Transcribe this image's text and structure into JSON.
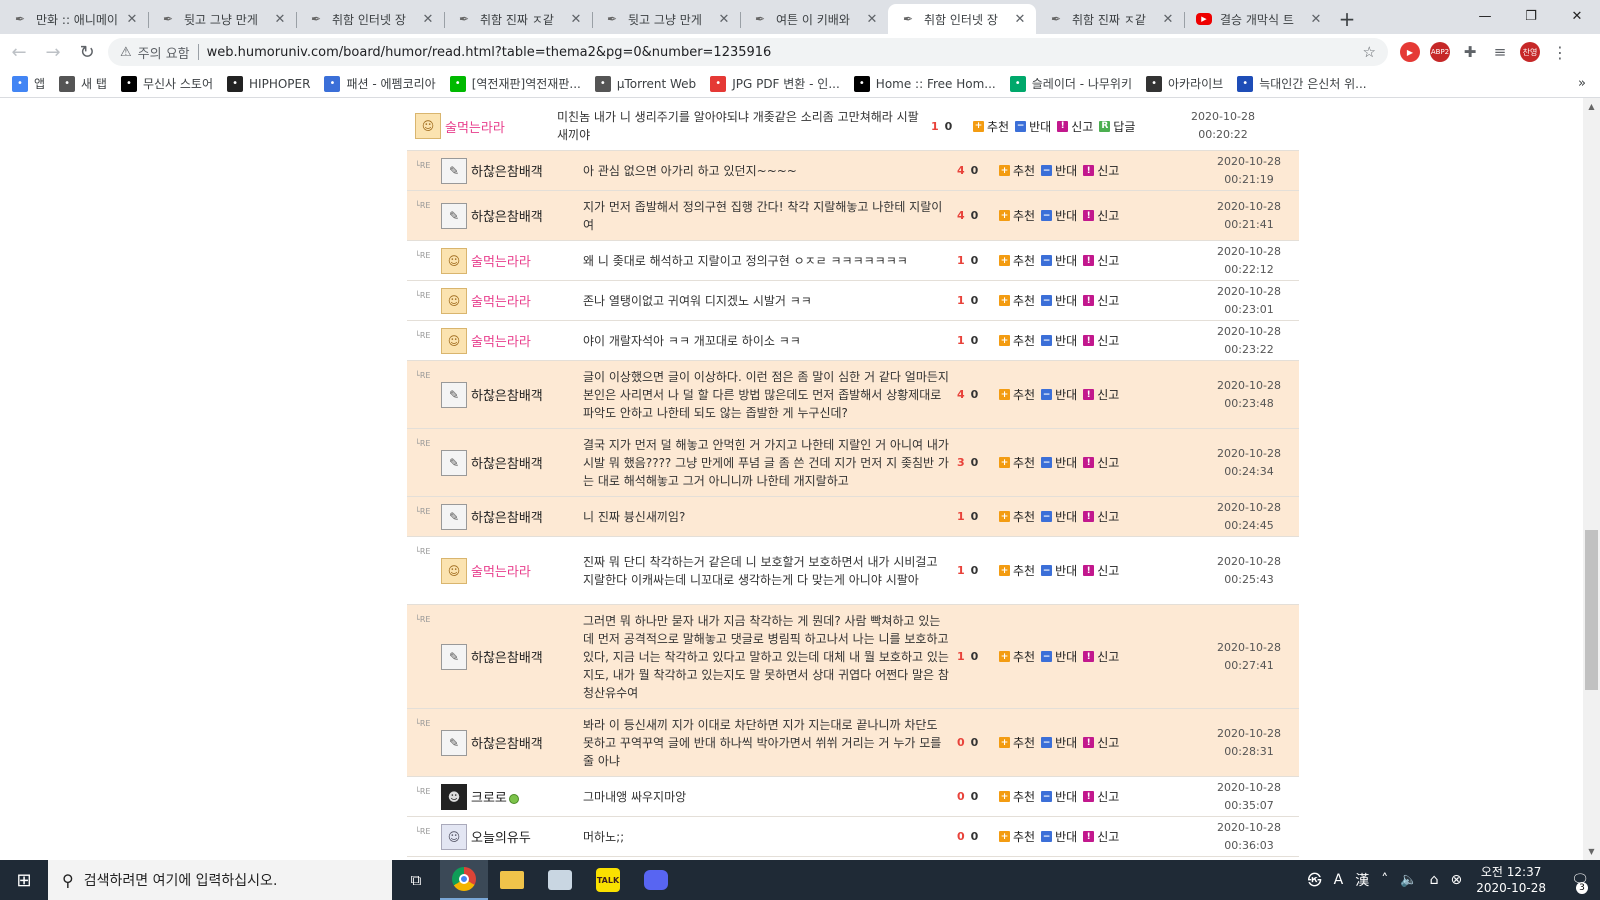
{
  "tabs": [
    {
      "title": "만화 :: 애니메이",
      "icon": "site-icon"
    },
    {
      "title": "뒷고 그냥 만게",
      "icon": "site-icon"
    },
    {
      "title": "취함 인터넷 장",
      "icon": "site-icon"
    },
    {
      "title": "취함 진짜 ㅈ같",
      "icon": "site-icon"
    },
    {
      "title": "뒷고 그냥 만게",
      "icon": "site-icon"
    },
    {
      "title": "여튼 이 키배와",
      "icon": "site-icon"
    },
    {
      "title": "취함 인터넷 장",
      "icon": "site-icon",
      "active": true
    },
    {
      "title": "취함 진짜 ㅈ같",
      "icon": "site-icon"
    },
    {
      "title": "결승 개막식 트",
      "icon": "youtube-icon"
    }
  ],
  "toolbar": {
    "security_label": "주의 요함",
    "url": "web.humoruniv.com/board/humor/read.html?table=thema2&pg=0&number=1235916"
  },
  "extensions": {
    "abp_badge": "2",
    "profile_label": "찬영"
  },
  "bookmarks": [
    {
      "label": "앱",
      "icon": "apps-icon",
      "color": "#4285f4"
    },
    {
      "label": "새 탭",
      "icon": "globe-icon",
      "color": "#555555"
    },
    {
      "label": "무신사 스토어",
      "icon": "musinsa-icon",
      "color": "#000000"
    },
    {
      "label": "HIPHOPER",
      "icon": "hiphoper-icon",
      "color": "#222222"
    },
    {
      "label": "패션 - 에펨코리아",
      "icon": "fmkorea-icon",
      "color": "#3b6fd8"
    },
    {
      "label": "[역전재판]역전재판...",
      "icon": "line-icon",
      "color": "#00b900"
    },
    {
      "label": "µTorrent Web",
      "icon": "utorrent-icon",
      "color": "#555555"
    },
    {
      "label": "JPG PDF 변환 - 인...",
      "icon": "grid-icon",
      "color": "#e53935"
    },
    {
      "label": "Home :: Free Hom...",
      "icon": "s-icon",
      "color": "#000000"
    },
    {
      "label": "슬레이더 - 나무위키",
      "icon": "namu-icon",
      "color": "#00a86b"
    },
    {
      "label": "아카라이브",
      "icon": "arca-icon",
      "color": "#333333"
    },
    {
      "label": "늑대인간 은신처 위...",
      "icon": "cube-icon",
      "color": "#1e4db7"
    }
  ],
  "comment_actions": {
    "recommend": "추천",
    "oppose": "반대",
    "report": "신고",
    "reply": "답글"
  },
  "comments": [
    {
      "reply": false,
      "avatar": "cat",
      "nick": "술먹는라라",
      "nick_color": "pink",
      "text": "미친놈 내가 니 생리주기를 알아야되냐 개좆같은 소리좀 고만쳐해라 시팔새끼야",
      "up": "1",
      "down": "0",
      "date": "2020-10-28",
      "time": "00:20:22",
      "has_reply_btn": true
    },
    {
      "reply": true,
      "avatar": "sketch",
      "nick": "하찮은참배객",
      "text": "아 관심 없으면 아가리 하고 있던지~~~~",
      "up": "4",
      "down": "0",
      "date": "2020-10-28",
      "time": "00:21:19"
    },
    {
      "reply": true,
      "avatar": "sketch",
      "nick": "하찮은참배객",
      "text": "지가 먼저 좁발해서 정의구현 집행 간다! 착각 지랄해놓고 나한테 지랄이여",
      "up": "4",
      "down": "0",
      "date": "2020-10-28",
      "time": "00:21:41"
    },
    {
      "reply": true,
      "avatar": "cat",
      "nick": "술먹는라라",
      "nick_color": "pink",
      "text": "왜 니 좆대로 해석하고 지랄이고 정의구현 ㅇㅈㄹ ㅋㅋㅋㅋㅋㅋㅋ",
      "up": "1",
      "down": "0",
      "date": "2020-10-28",
      "time": "00:22:12"
    },
    {
      "reply": true,
      "avatar": "cat",
      "nick": "술먹는라라",
      "nick_color": "pink",
      "text": "존나 열탱이없고 귀여워 디지겠노 시발거 ㅋㅋ",
      "up": "1",
      "down": "0",
      "date": "2020-10-28",
      "time": "00:23:01"
    },
    {
      "reply": true,
      "avatar": "cat",
      "nick": "술먹는라라",
      "nick_color": "pink",
      "text": "야이 개랄자석아 ㅋㅋ 개꼬대로 하이소 ㅋㅋ",
      "up": "1",
      "down": "0",
      "date": "2020-10-28",
      "time": "00:23:22"
    },
    {
      "reply": true,
      "avatar": "sketch",
      "nick": "하찮은참배객",
      "text": "글이 이상했으면 글이 이상하다. 이런 점은 좀 말이 심한 거 같다 얼마든지 본인은 사리면서 나 덜 할 다른 방법 많은데도 먼저 좁발해서 상황제대로 파악도 안하고 나한테 되도 않는 좁발한 게 누구신데?",
      "up": "4",
      "down": "0",
      "date": "2020-10-28",
      "time": "00:23:48"
    },
    {
      "reply": true,
      "avatar": "sketch",
      "nick": "하찮은참배객",
      "text": "결국 지가 먼저 덜 해놓고 안먹힌 거 가지고 나한테 지랄인 거 아니여 내가 시발 뭐 했음???? 그냥 만게에 푸념 글 좀 쓴 건데 지가 먼저 지 좆침반 가는 대로 해석해놓고 그거 아니니까 나한테 개지랄하고",
      "up": "3",
      "down": "0",
      "date": "2020-10-28",
      "time": "00:24:34"
    },
    {
      "reply": true,
      "avatar": "sketch",
      "nick": "하찮은참배객",
      "text": "니 진짜 븅신새끼임?",
      "up": "1",
      "down": "0",
      "date": "2020-10-28",
      "time": "00:24:45"
    },
    {
      "reply": true,
      "avatar": "cat",
      "nick": "술먹는라라",
      "nick_color": "pink",
      "text": "진짜 뭐 단디 착각하는거 같은데 니 보호할거 보호하면서 내가 시비걸고 지랄한다 이캐싸는데 니꼬대로 생각하는게 다 맞는게 아니야 시팔아",
      "up": "1",
      "down": "0",
      "date": "2020-10-28",
      "time": "00:25:43"
    },
    {
      "reply": true,
      "avatar": "sketch",
      "nick": "하찮은참배객",
      "text": "그러면 뭐 하나만 묻자 내가 지금 착각하는 게 뭔데? 사람 빡쳐하고 있는데 먼저 공격적으로 말해놓고 댓글로 병림픽 하고나서 나는 니를 보호하고 있다, 지금 너는 착각하고 있다고 말하고 있는데 대체 내 뭘 보호하고 있는지도, 내가 뭘 착각하고 있는지도 말 못하면서 상대 귀엽다 어쩐다 말은 참 청산유수여",
      "up": "1",
      "down": "0",
      "date": "2020-10-28",
      "time": "00:27:41"
    },
    {
      "reply": true,
      "avatar": "sketch",
      "nick": "하찮은참배객",
      "text": "봐라 이 등신새끼 지가 이대로 차단하면 지가 지는대로 끝나니까 차단도 못하고 꾸역꾸역 글에 반대 하나씩 박아가면서 쒸쒸 거리는 거 누가 모를 줄 아냐",
      "up": "0",
      "down": "0",
      "date": "2020-10-28",
      "time": "00:28:31"
    },
    {
      "reply": true,
      "avatar": "black",
      "nick": "크로로",
      "level_badge": true,
      "text": "그마내앵 싸우지마앙",
      "up": "0",
      "down": "0",
      "date": "2020-10-28",
      "time": "00:35:07"
    },
    {
      "reply": true,
      "avatar": "anime",
      "nick": "오늘의유두",
      "text": "머하노;;",
      "up": "0",
      "down": "0",
      "date": "2020-10-28",
      "time": "00:36:03"
    }
  ],
  "reply_marker": "└RE",
  "taskbar": {
    "search_placeholder": "검색하려면 여기에 입력하십시오.",
    "ime_label": "A",
    "ime_hanja": "漢",
    "clock_ampm_time": "오전 12:37",
    "clock_date": "2020-10-28",
    "notif_count": "3"
  }
}
